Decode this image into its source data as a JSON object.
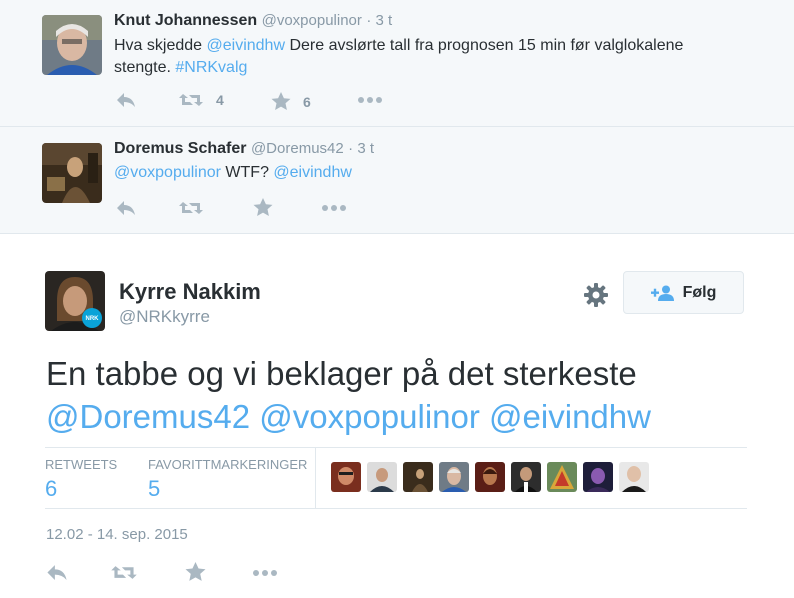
{
  "replies": [
    {
      "name": "Knut Johannessen",
      "handle": "@voxpopulinor",
      "time": "· 3 t",
      "line1_prefix": "Hva skjedde ",
      "line1_mention": "@eivindhw",
      "line1_suffix": " Dere avslørte tall fra prognosen 15 min før valglokalene",
      "line2_text": "stengte. ",
      "line2_hashtag": "#NRKvalg",
      "retweets": "4",
      "favorites": "6"
    },
    {
      "name": "Doremus Schafer",
      "handle": "@Doremus42",
      "time": "· 3 t",
      "mention1": "@voxpopulinor",
      "middle": " WTF? ",
      "mention2": "@eivindhw"
    }
  ],
  "tweet": {
    "name": "Kyrre Nakkim",
    "handle": "@NRKkyrre",
    "follow_label": "Følg",
    "text_line1": "En tabbe og vi beklager på det sterkeste",
    "mentions": [
      "@Doremus42",
      "@voxpopulinor",
      "@eivindhw"
    ],
    "stats": {
      "retweets_label": "RETWEETS",
      "retweets_value": "6",
      "favorites_label": "FAVORITTMARKERINGER",
      "favorites_value": "5"
    },
    "date": "12.02 - 14. sep. 2015",
    "badge_text": "NRK"
  },
  "colors": {
    "link": "#55acee",
    "muted": "#8899a6",
    "icon": "#aab8c2",
    "reply_bg": "#f5f8fa"
  }
}
